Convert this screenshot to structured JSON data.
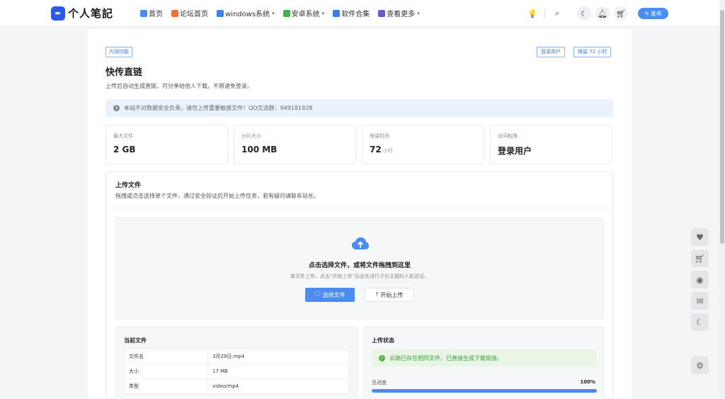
{
  "header": {
    "logo_text": "个人笔記",
    "nav": [
      {
        "label": "首页",
        "icon": "home-icon",
        "color": "#4a8cf0",
        "has_dropdown": false
      },
      {
        "label": "论坛首页",
        "icon": "forum-icon",
        "color": "#e9743b",
        "has_dropdown": false
      },
      {
        "label": "windows系统",
        "icon": "windows-icon",
        "color": "#3b86e0",
        "has_dropdown": true
      },
      {
        "label": "安卓系统",
        "icon": "android-icon",
        "color": "#45b050",
        "has_dropdown": true
      },
      {
        "label": "软件合集",
        "icon": "apps-icon",
        "color": "#3b7de0",
        "has_dropdown": false
      },
      {
        "label": "查看更多",
        "icon": "more-icon",
        "color": "#6a5acd",
        "has_dropdown": true
      }
    ],
    "publish_label": "发布"
  },
  "page": {
    "beta_badge": "内测功能",
    "login_badge": "登录用户",
    "retain_badge": "保留 72 小时",
    "title": "快传直链",
    "subtitle": "上传后自动生成直链，可分享给他人下载，不限速免登录。",
    "notice": "本站不对数据安全负责，请勿上传重要敏感文件！QQ交流群：949181928"
  },
  "stats": [
    {
      "label": "最大文件",
      "value": "2 GB",
      "unit": ""
    },
    {
      "label": "分片大小",
      "value": "100 MB",
      "unit": ""
    },
    {
      "label": "保留时间",
      "value": "72",
      "unit": "小时"
    },
    {
      "label": "访问权限",
      "value": "登录用户",
      "unit": ""
    }
  ],
  "upload": {
    "title": "上传文件",
    "desc": "拖拽或点击选择单个文件，通过安全验证后开始上传任务，若有疑问请联系站长。",
    "dz_title": "点击选择文件，或将文件拖拽到这里",
    "dz_sub": "单文件上传，点击“开始上传”后会先进行子比主题的人机验证。",
    "select_label": "选择文件",
    "start_label": "开始上传"
  },
  "current_file": {
    "title": "当前文件",
    "rows": [
      {
        "key": "文件名",
        "value": "3月29日.mp4"
      },
      {
        "key": "大小",
        "value": "17 MB"
      },
      {
        "key": "类型",
        "value": "video/mp4"
      }
    ]
  },
  "status": {
    "title": "上传状态",
    "message": "云端已存在相同文件，已直接生成下载链接。",
    "progress_label": "总进度",
    "progress_text": "100%",
    "progress": 1.0
  },
  "colors": {
    "accent": "#4a8cf0",
    "success": "#52b44b"
  }
}
